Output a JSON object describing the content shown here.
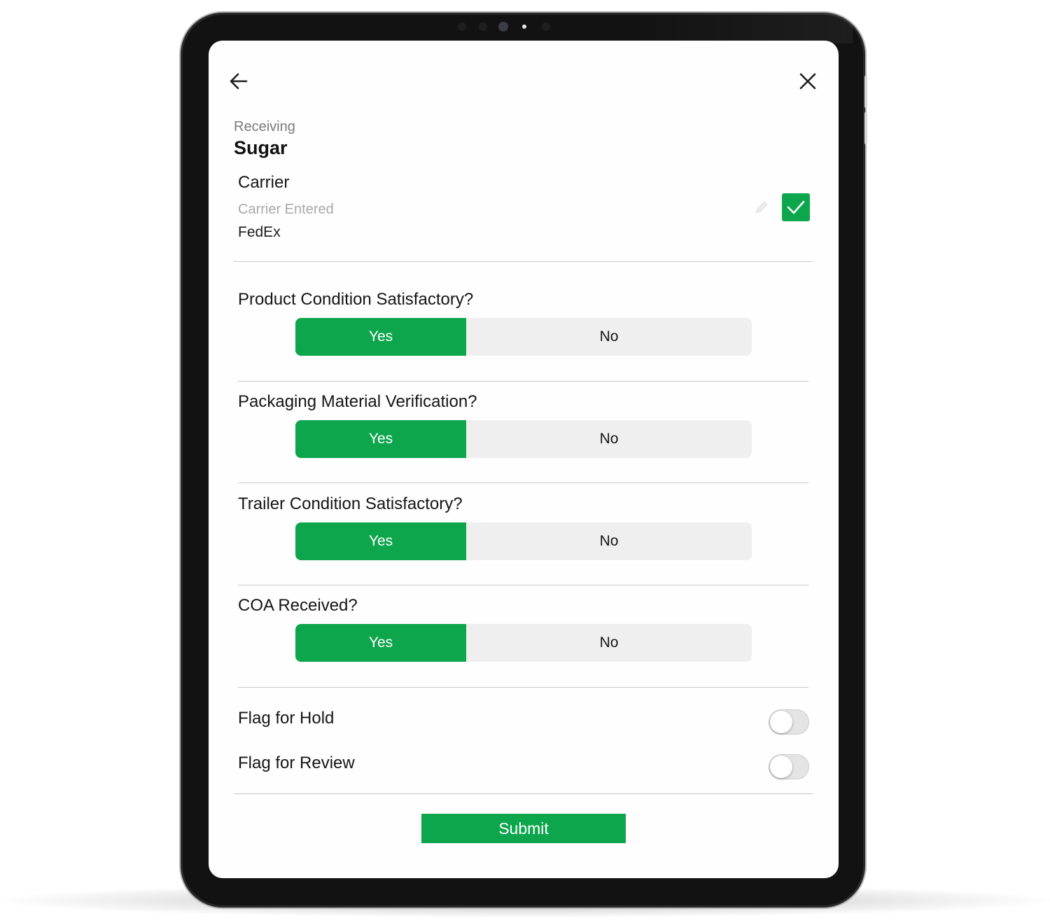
{
  "header": {
    "breadcrumb": "Receiving",
    "title": "Sugar",
    "back_icon": "arrow-left-icon",
    "close_icon": "close-icon"
  },
  "carrier": {
    "section_label": "Carrier",
    "field_label": "Carrier Entered",
    "field_value": "FedEx",
    "edit_icon": "pencil-icon",
    "confirm_icon": "checkmark-icon"
  },
  "questions": [
    {
      "label": "Product Condition Satisfactory?",
      "yes": "Yes",
      "no": "No",
      "selected": "Yes"
    },
    {
      "label": "Packaging Material Verification?",
      "yes": "Yes",
      "no": "No",
      "selected": "Yes"
    },
    {
      "label": "Trailer Condition Satisfactory?",
      "yes": "Yes",
      "no": "No",
      "selected": "Yes"
    },
    {
      "label": "COA Received?",
      "yes": "Yes",
      "no": "No",
      "selected": "Yes"
    }
  ],
  "flags": [
    {
      "label": "Flag for Hold",
      "on": false
    },
    {
      "label": "Flag for Review",
      "on": false
    }
  ],
  "submit_label": "Submit",
  "colors": {
    "accent": "#0ea64d",
    "segment_background": "#efefef",
    "device_frame": "#121212"
  }
}
